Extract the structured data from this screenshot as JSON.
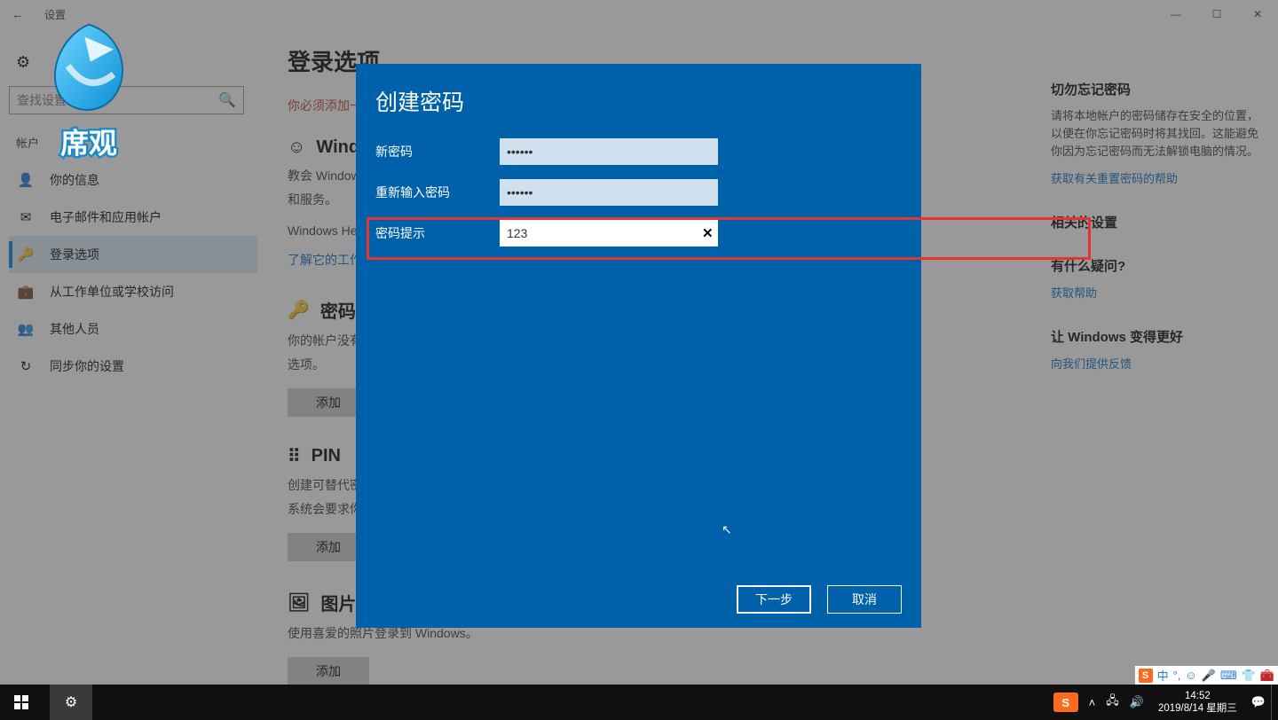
{
  "window": {
    "title": "设置",
    "controls": {
      "min": "—",
      "max": "☐",
      "close": "✕"
    },
    "back": "←"
  },
  "leftcol": {
    "search_placeholder": "查找设置",
    "category": "帐户",
    "items": [
      {
        "icon": "👤",
        "label": "你的信息"
      },
      {
        "icon": "✉",
        "label": "电子邮件和应用帐户"
      },
      {
        "icon": "🔑",
        "label": "登录选项"
      },
      {
        "icon": "💼",
        "label": "从工作单位或学校访问"
      },
      {
        "icon": "👥",
        "label": "其他人员"
      },
      {
        "icon": "↻",
        "label": "同步你的设置"
      }
    ]
  },
  "main": {
    "heading": "登录选项",
    "warn_line": "你必须添加一",
    "sec_hello": {
      "title": "Windows",
      "p1": "教会 Windows",
      "p2": "和服务。",
      "p3": "Windows He",
      "link": "了解它的工作"
    },
    "sec_password": {
      "title": "密码",
      "p1": "你的帐户没有",
      "p2": "选项。",
      "btn": "添加"
    },
    "sec_pin": {
      "title": "PIN",
      "p1": "创建可替代密",
      "p2": "系统会要求你",
      "btn": "添加"
    },
    "sec_pic": {
      "title": "图片密",
      "p1": "使用喜爱的照片登录到 Windows。",
      "btn": "添加"
    }
  },
  "rightcol": {
    "b1_title": "切勿忘记密码",
    "b1_text": "请将本地帐户的密码储存在安全的位置，以便在你忘记密码时将其找回。这能避免你因为忘记密码而无法解锁电脑的情况。",
    "b1_link": "获取有关重置密码的帮助",
    "b2_title": "相关的设置",
    "b3_title": "有什么疑问?",
    "b3_link": "获取帮助",
    "b4_title": "让 Windows 变得更好",
    "b4_link": "向我们提供反馈"
  },
  "dialog": {
    "title": "创建密码",
    "labels": {
      "new": "新密码",
      "confirm": "重新输入密码",
      "hint": "密码提示"
    },
    "values": {
      "new": "••••••",
      "confirm": "••••••",
      "hint": "123"
    },
    "btn_next": "下一步",
    "btn_cancel": "取消"
  },
  "taskbar": {
    "clock_time": "14:52",
    "clock_date": "2019/8/14 星期三",
    "ime": "中"
  }
}
